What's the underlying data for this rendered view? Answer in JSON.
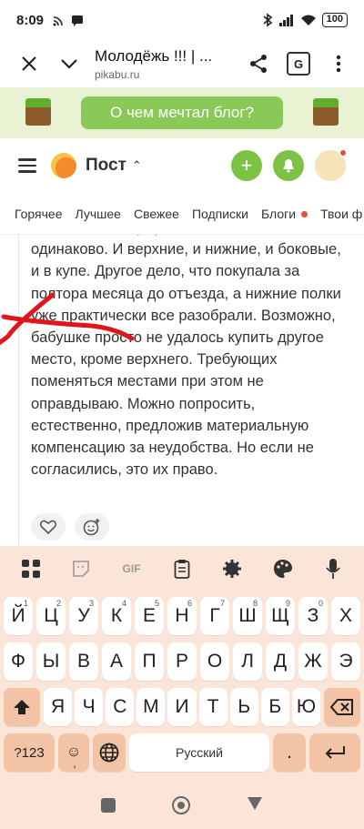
{
  "status": {
    "time": "8:09",
    "battery": "100"
  },
  "browser": {
    "title": "Молодёжь !!! | ...",
    "url": "pikabu.ru"
  },
  "banner": {
    "label": "О чем мечтал блог?"
  },
  "header": {
    "title": "Пост"
  },
  "tabs": [
    "Горячее",
    "Лучшее",
    "Свежее",
    "Подписки",
    "Блоги",
    "Твои ф"
  ],
  "comment": {
    "text": "... места в плацкартном вагоне стоят одинаково. И верхние, и нижние, и боковые, и в купе. Другое дело, что покупала за полтора месяца до отъезда, а нижние полки уже практически все разобрали. Возможно, бабушке просто не удалось купить другое место, кроме верхнего. Требующих поменяться местами при этом не оправдываю. Можно попросить, естественно, предложив материальную компенсацию за неудобства. Но если не согласились, это их право."
  },
  "keyboard": {
    "gif_label": "GIF",
    "row1": [
      {
        "k": "Й",
        "h": "1"
      },
      {
        "k": "Ц",
        "h": "2"
      },
      {
        "k": "У",
        "h": "3"
      },
      {
        "k": "К",
        "h": "4"
      },
      {
        "k": "Е",
        "h": "5"
      },
      {
        "k": "Н",
        "h": "6"
      },
      {
        "k": "Г",
        "h": "7"
      },
      {
        "k": "Ш",
        "h": "8"
      },
      {
        "k": "Щ",
        "h": "9"
      },
      {
        "k": "З",
        "h": "0"
      },
      {
        "k": "Х",
        "h": ""
      }
    ],
    "row2": [
      "Ф",
      "Ы",
      "В",
      "А",
      "П",
      "Р",
      "О",
      "Л",
      "Д",
      "Ж",
      "Э"
    ],
    "row3": [
      "Я",
      "Ч",
      "С",
      "М",
      "И",
      "Т",
      "Ь",
      "Б",
      "Ю"
    ],
    "numbers_key": "?123",
    "emoji_key": "☺",
    "emoji_hint": ",",
    "space_label": "Русский",
    "period_key": "."
  },
  "colors": {
    "accent_green": "#8ac858",
    "banner_bg": "#e9f3d4",
    "keyboard_bg": "#fbe5d8",
    "annotation_red": "#e0161b"
  }
}
